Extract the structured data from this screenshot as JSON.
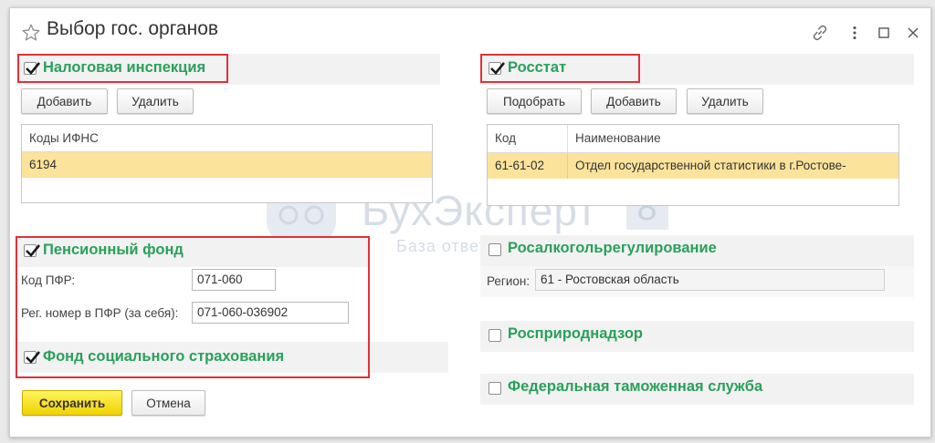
{
  "window": {
    "title": "Выбор гос. органов",
    "icons": [
      "star-icon",
      "link-icon",
      "more-icon",
      "maximize-icon",
      "close-icon"
    ]
  },
  "nalog": {
    "title": "Налоговая инспекция",
    "checked": true,
    "add_label": "Добавить",
    "delete_label": "Удалить",
    "column": "Коды ИФНС",
    "rows": [
      "6194"
    ]
  },
  "rosstat": {
    "title": "Росстат",
    "checked": true,
    "pick_label": "Подобрать",
    "add_label": "Добавить",
    "delete_label": "Удалить",
    "columns": [
      "Код",
      "Наименование"
    ],
    "rows": [
      [
        "61-61-02",
        "Отдел государственной статистики в г.Ростове-"
      ]
    ]
  },
  "pfr": {
    "title": "Пенсионный фонд",
    "checked": true,
    "code_label": "Код ПФР:",
    "code_value": "071-060",
    "reg_label": "Рег. номер в ПФР (за себя):",
    "reg_value": "071-060-036902"
  },
  "fss": {
    "title": "Фонд социального страхования",
    "checked": true
  },
  "rosalko": {
    "title": "Росалкогольрегулирование",
    "checked": false,
    "region_label": "Регион:",
    "region_value": "61 - Ростовская область"
  },
  "rospriroda": {
    "title": "Росприроднадзор",
    "checked": false
  },
  "fts": {
    "title": "Федеральная таможенная служба",
    "checked": false
  },
  "footer": {
    "save_label": "Сохранить",
    "cancel_label": "Отмена"
  },
  "watermark": {
    "brand": "БухЭксперт",
    "digit": "8",
    "sub": "База ответов"
  },
  "colors": {
    "group_title": "#2aa05a",
    "highlight": "#e0313a",
    "selected_row": "#fbe39c",
    "primary_button": "#f5dc1c"
  }
}
